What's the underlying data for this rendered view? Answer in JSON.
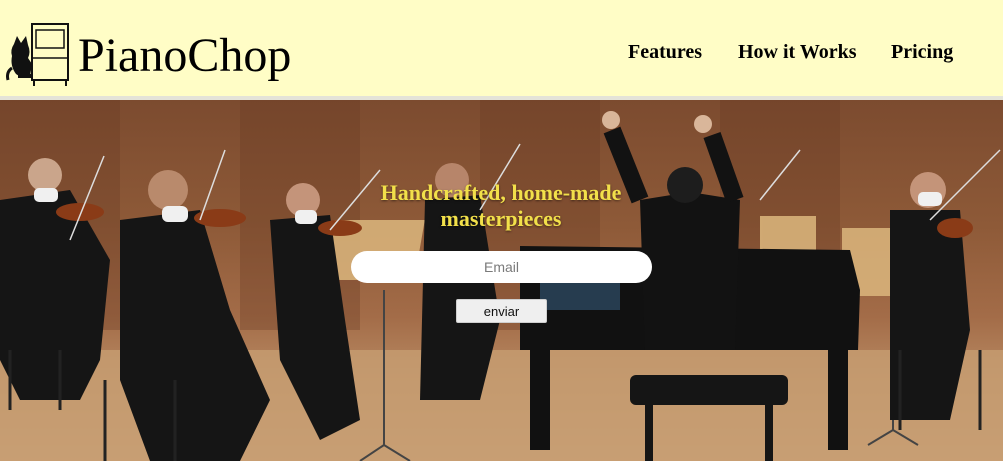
{
  "brand": {
    "name": "PianoChop",
    "logo_icon": "piano-cat-logo-icon"
  },
  "nav": {
    "items": [
      {
        "label": "Features"
      },
      {
        "label": "How it Works"
      },
      {
        "label": "Pricing"
      }
    ]
  },
  "hero": {
    "title": "Handcrafted, home-made masterpieces",
    "email_placeholder": "Email",
    "submit_label": "enviar",
    "background": "orchestra-photo"
  },
  "colors": {
    "header_bg": "#fffdc6",
    "title_yellow": "#f2e04a",
    "wood": "#8e5a38"
  }
}
